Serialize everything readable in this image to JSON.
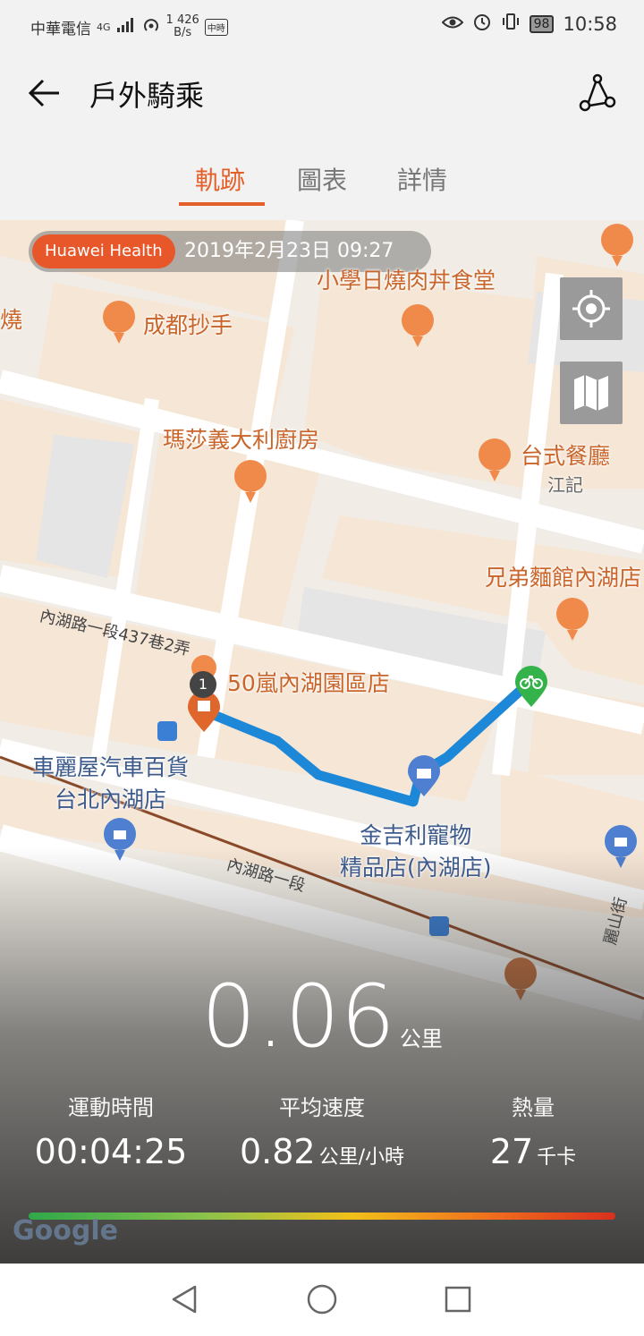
{
  "status_bar": {
    "carrier": "中華電信",
    "network": "4G",
    "speed_value": "426",
    "speed_unit": "B/s",
    "speed_prefix": "1",
    "news_badge": "中時",
    "battery": "98",
    "time": "10:58"
  },
  "app_bar": {
    "title": "戶外騎乘"
  },
  "tabs": [
    {
      "label": "軌跡",
      "active": true
    },
    {
      "label": "圖表",
      "active": false
    },
    {
      "label": "詳情",
      "active": false
    }
  ],
  "map": {
    "badge_brand": "Huawei Health",
    "badge_date": "2019年2月23日 09:27",
    "pois": [
      {
        "name": "小學日燒肉丼食堂"
      },
      {
        "name": "成都抄手"
      },
      {
        "name": "燒"
      },
      {
        "name": "瑪莎義大利廚房"
      },
      {
        "name": "台式餐廳",
        "sub": "江記"
      },
      {
        "name": "兄弟麵館內湖店"
      },
      {
        "name": "50嵐內湖園區店"
      },
      {
        "name": "車麗屋汽車百貨",
        "sub2": "台北內湖店"
      },
      {
        "name": "金吉利寵物",
        "sub2": "精品店(內湖店)"
      }
    ],
    "roads": [
      "內湖路一段437巷2弄",
      "內湖路一段",
      "麗山街"
    ],
    "start_marker": "1",
    "google_logo": "Google"
  },
  "summary": {
    "distance_value": "0.06",
    "distance_unit": "公里",
    "stats": [
      {
        "label": "運動時間",
        "value": "00:04:25",
        "unit": ""
      },
      {
        "label": "平均速度",
        "value": "0.82",
        "unit": "公里/小時"
      },
      {
        "label": "熱量",
        "value": "27",
        "unit": "千卡"
      }
    ]
  },
  "colors": {
    "accent": "#e4602a",
    "track": "#1e88d8"
  }
}
